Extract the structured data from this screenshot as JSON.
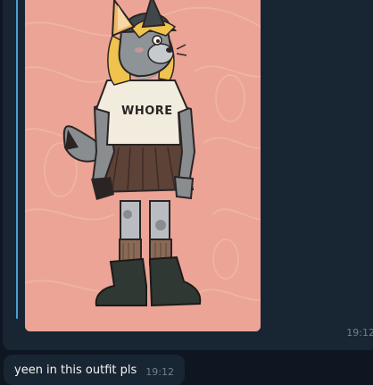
{
  "messages": [
    {
      "type": "photo",
      "image_label": "illustration-character",
      "shirt_text": "WHORE",
      "time": "19:12"
    },
    {
      "type": "text",
      "text": "yeen in this outfit pls",
      "time": "19:12"
    }
  ],
  "colors": {
    "background": "#0e1621",
    "bubble": "#182533",
    "reply_accent": "#4e9ed8",
    "time": "#6d7f8f",
    "text": "#f5f5f5"
  }
}
